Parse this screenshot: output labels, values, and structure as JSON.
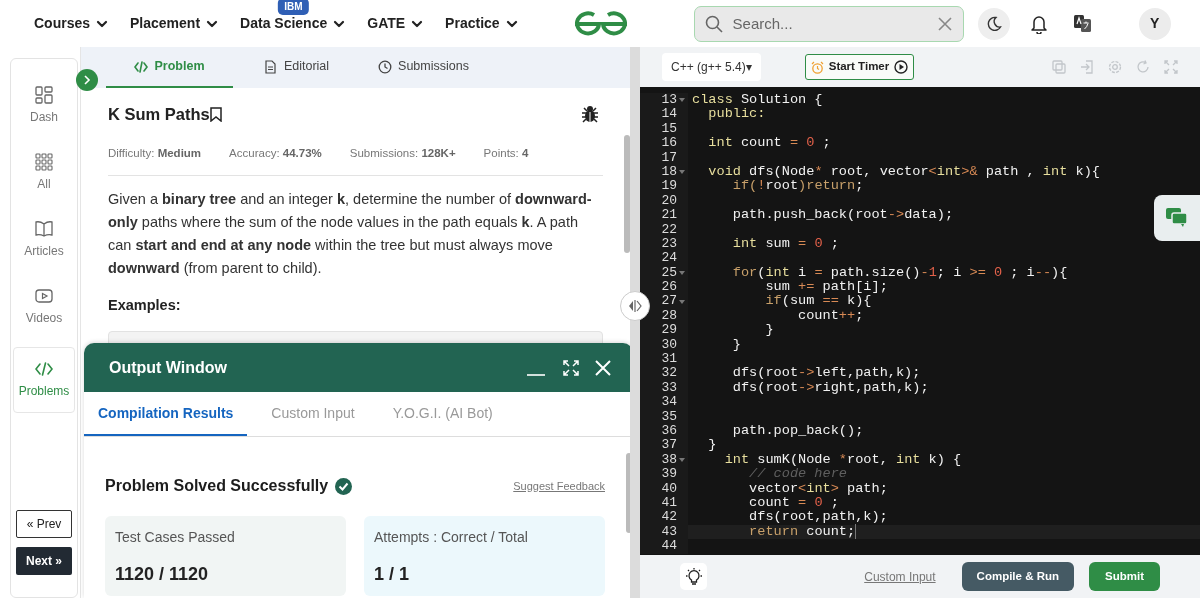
{
  "nav": {
    "menus": [
      {
        "label": "Courses"
      },
      {
        "label": "Placement"
      },
      {
        "label": "Data Science",
        "badge": "IBM"
      },
      {
        "label": "GATE"
      },
      {
        "label": "Practice"
      }
    ],
    "search": {
      "placeholder": "Search..."
    },
    "avatar": "Y"
  },
  "sidebar": {
    "items": [
      {
        "label": "Dash",
        "kind": "dash",
        "selected": false
      },
      {
        "label": "All",
        "kind": "all",
        "selected": false
      },
      {
        "label": "Articles",
        "kind": "articles",
        "selected": false
      },
      {
        "label": "Videos",
        "kind": "videos",
        "selected": false
      },
      {
        "label": "Problems",
        "kind": "code",
        "selected": true
      }
    ],
    "prev": "« Prev",
    "next": "Next »"
  },
  "problem": {
    "tabs": [
      {
        "label": "Problem",
        "kind": "code",
        "selected": true
      },
      {
        "label": "Editorial",
        "kind": "doc",
        "selected": false
      },
      {
        "label": "Submissions",
        "kind": "clock",
        "selected": false
      }
    ],
    "title": "K Sum Paths",
    "meta": [
      "Difficulty: **Medium**",
      "Accuracy: **44.73%**",
      "Submissions: **128K+**",
      "Points: **4**"
    ],
    "description": "Given a **binary tree** and an integer **k**, determine the number of **downward-only** paths where the sum of the node values in the path equals **k**. A path can **start and end at any node** within the tree but must always move **downward** (from parent to child).",
    "examples_heading": "Examples:"
  },
  "output": {
    "title": "Output Window",
    "tabs": [
      {
        "label": "Compilation Results",
        "selected": true
      },
      {
        "label": "Custom Input",
        "selected": false
      },
      {
        "label": "Y.O.G.I. (AI Bot)",
        "selected": false
      }
    ],
    "status": "Problem Solved Successfully",
    "feedback": "Suggest Feedback",
    "cards": [
      {
        "kind": "tests",
        "label": "Test Cases Passed",
        "value": "1120 / 1120"
      },
      {
        "kind": "attempts",
        "label": "Attempts : Correct / Total",
        "value": "1 / 1"
      }
    ]
  },
  "editor": {
    "language": "C++ (g++ 5.4)▾",
    "timer": "Start Timer",
    "lines": [
      {
        "num": "13",
        "fold": true,
        "current": false,
        "segments": [
          {
            "kind": "type",
            "text": "class"
          },
          {
            "kind": "plain",
            "text": " Solution {"
          }
        ]
      },
      {
        "num": "14",
        "fold": false,
        "current": false,
        "segments": [
          {
            "kind": "type",
            "text": "  public:"
          }
        ]
      },
      {
        "num": "15",
        "fold": false,
        "current": false
      },
      {
        "num": "16",
        "fold": false,
        "current": false,
        "segments": [
          {
            "kind": "type",
            "text": "  int"
          },
          {
            "kind": "plain",
            "text": " count "
          },
          {
            "kind": "op",
            "text": "= "
          },
          {
            "kind": "num",
            "text": "0"
          },
          {
            "kind": "plain",
            "text": " ;"
          }
        ]
      },
      {
        "num": "17",
        "fold": false,
        "current": false
      },
      {
        "num": "18",
        "fold": true,
        "current": false,
        "segments": [
          {
            "kind": "type",
            "text": "  void"
          },
          {
            "kind": "plain",
            "text": " dfs(Node"
          },
          {
            "kind": "op",
            "text": "*"
          },
          {
            "kind": "plain",
            "text": " root, vector"
          },
          {
            "kind": "op",
            "text": "<"
          },
          {
            "kind": "type",
            "text": "int"
          },
          {
            "kind": "op",
            "text": ">&"
          },
          {
            "kind": "plain",
            "text": " path , "
          },
          {
            "kind": "type",
            "text": "int"
          },
          {
            "kind": "plain",
            "text": " k){"
          }
        ]
      },
      {
        "num": "19",
        "fold": false,
        "current": false,
        "segments": [
          {
            "kind": "ctrl",
            "text": "     if("
          },
          {
            "kind": "op",
            "text": "!"
          },
          {
            "kind": "plain",
            "text": "root"
          },
          {
            "kind": "ctrl",
            "text": ")return"
          },
          {
            "kind": "plain",
            "text": ";"
          }
        ]
      },
      {
        "num": "20",
        "fold": false,
        "current": false
      },
      {
        "num": "21",
        "fold": false,
        "current": false,
        "segments": [
          {
            "kind": "plain",
            "text": "     path.push_back(root"
          },
          {
            "kind": "op",
            "text": "->"
          },
          {
            "kind": "plain",
            "text": "data);"
          }
        ]
      },
      {
        "num": "22",
        "fold": false,
        "current": false
      },
      {
        "num": "23",
        "fold": false,
        "current": false,
        "segments": [
          {
            "kind": "type",
            "text": "     int"
          },
          {
            "kind": "plain",
            "text": " sum "
          },
          {
            "kind": "op",
            "text": "= "
          },
          {
            "kind": "num",
            "text": "0"
          },
          {
            "kind": "plain",
            "text": " ;"
          }
        ]
      },
      {
        "num": "24",
        "fold": false,
        "current": false
      },
      {
        "num": "25",
        "fold": true,
        "current": false,
        "segments": [
          {
            "kind": "ctrl",
            "text": "     for"
          },
          {
            "kind": "plain",
            "text": "("
          },
          {
            "kind": "type",
            "text": "int"
          },
          {
            "kind": "plain",
            "text": " i "
          },
          {
            "kind": "op",
            "text": "="
          },
          {
            "kind": "plain",
            "text": " path.size()"
          },
          {
            "kind": "op",
            "text": "-"
          },
          {
            "kind": "num",
            "text": "1"
          },
          {
            "kind": "plain",
            "text": "; i "
          },
          {
            "kind": "op",
            "text": ">= "
          },
          {
            "kind": "num",
            "text": "0"
          },
          {
            "kind": "plain",
            "text": " ; i"
          },
          {
            "kind": "op",
            "text": "--"
          },
          {
            "kind": "plain",
            "text": "){"
          }
        ]
      },
      {
        "num": "26",
        "fold": false,
        "current": false,
        "segments": [
          {
            "kind": "plain",
            "text": "         sum "
          },
          {
            "kind": "op",
            "text": "+="
          },
          {
            "kind": "plain",
            "text": " path[i];"
          }
        ]
      },
      {
        "num": "27",
        "fold": true,
        "current": false,
        "segments": [
          {
            "kind": "ctrl",
            "text": "         if"
          },
          {
            "kind": "plain",
            "text": "(sum "
          },
          {
            "kind": "op",
            "text": "=="
          },
          {
            "kind": "plain",
            "text": " k){"
          }
        ]
      },
      {
        "num": "28",
        "fold": false,
        "current": false,
        "segments": [
          {
            "kind": "plain",
            "text": "             count"
          },
          {
            "kind": "op",
            "text": "++"
          },
          {
            "kind": "plain",
            "text": ";"
          }
        ]
      },
      {
        "num": "29",
        "fold": false,
        "current": false,
        "segments": [
          {
            "kind": "plain",
            "text": "         }"
          }
        ]
      },
      {
        "num": "30",
        "fold": false,
        "current": false,
        "segments": [
          {
            "kind": "plain",
            "text": "     }"
          }
        ]
      },
      {
        "num": "31",
        "fold": false,
        "current": false
      },
      {
        "num": "32",
        "fold": false,
        "current": false,
        "segments": [
          {
            "kind": "plain",
            "text": "     dfs(root"
          },
          {
            "kind": "op",
            "text": "->"
          },
          {
            "kind": "plain",
            "text": "left,path,k);"
          }
        ]
      },
      {
        "num": "33",
        "fold": false,
        "current": false,
        "segments": [
          {
            "kind": "plain",
            "text": "     dfs(root"
          },
          {
            "kind": "op",
            "text": "->"
          },
          {
            "kind": "plain",
            "text": "right,path,k);"
          }
        ]
      },
      {
        "num": "34",
        "fold": false,
        "current": false
      },
      {
        "num": "35",
        "fold": false,
        "current": false
      },
      {
        "num": "36",
        "fold": false,
        "current": false,
        "segments": [
          {
            "kind": "plain",
            "text": "     path.pop_back();"
          }
        ]
      },
      {
        "num": "37",
        "fold": false,
        "current": false,
        "segments": [
          {
            "kind": "plain",
            "text": "  }"
          }
        ]
      },
      {
        "num": "38",
        "fold": true,
        "current": false,
        "segments": [
          {
            "kind": "type",
            "text": "    int"
          },
          {
            "kind": "plain",
            "text": " sumK(Node "
          },
          {
            "kind": "op",
            "text": "*"
          },
          {
            "kind": "plain",
            "text": "root, "
          },
          {
            "kind": "type",
            "text": "int"
          },
          {
            "kind": "plain",
            "text": " k) {"
          }
        ]
      },
      {
        "num": "39",
        "fold": false,
        "current": false,
        "segments": [
          {
            "kind": "comment",
            "text": "       // code here"
          }
        ]
      },
      {
        "num": "40",
        "fold": false,
        "current": false,
        "segments": [
          {
            "kind": "plain",
            "text": "       vector"
          },
          {
            "kind": "op",
            "text": "<"
          },
          {
            "kind": "type",
            "text": "int"
          },
          {
            "kind": "op",
            "text": ">"
          },
          {
            "kind": "plain",
            "text": " path;"
          }
        ]
      },
      {
        "num": "41",
        "fold": false,
        "current": false,
        "segments": [
          {
            "kind": "plain",
            "text": "       count "
          },
          {
            "kind": "op",
            "text": "= "
          },
          {
            "kind": "num",
            "text": "0"
          },
          {
            "kind": "plain",
            "text": " ;"
          }
        ]
      },
      {
        "num": "42",
        "fold": false,
        "current": false,
        "segments": [
          {
            "kind": "plain",
            "text": "       dfs(root,path,k);"
          }
        ]
      },
      {
        "num": "43",
        "fold": false,
        "current": true,
        "segments": [
          {
            "kind": "ctrl",
            "text": "       return"
          },
          {
            "kind": "plain",
            "text": " count;"
          }
        ]
      },
      {
        "num": "44",
        "fold": false,
        "current": false
      }
    ],
    "custom_input": "Custom Input",
    "compile": "Compile & Run",
    "submit": "Submit"
  }
}
